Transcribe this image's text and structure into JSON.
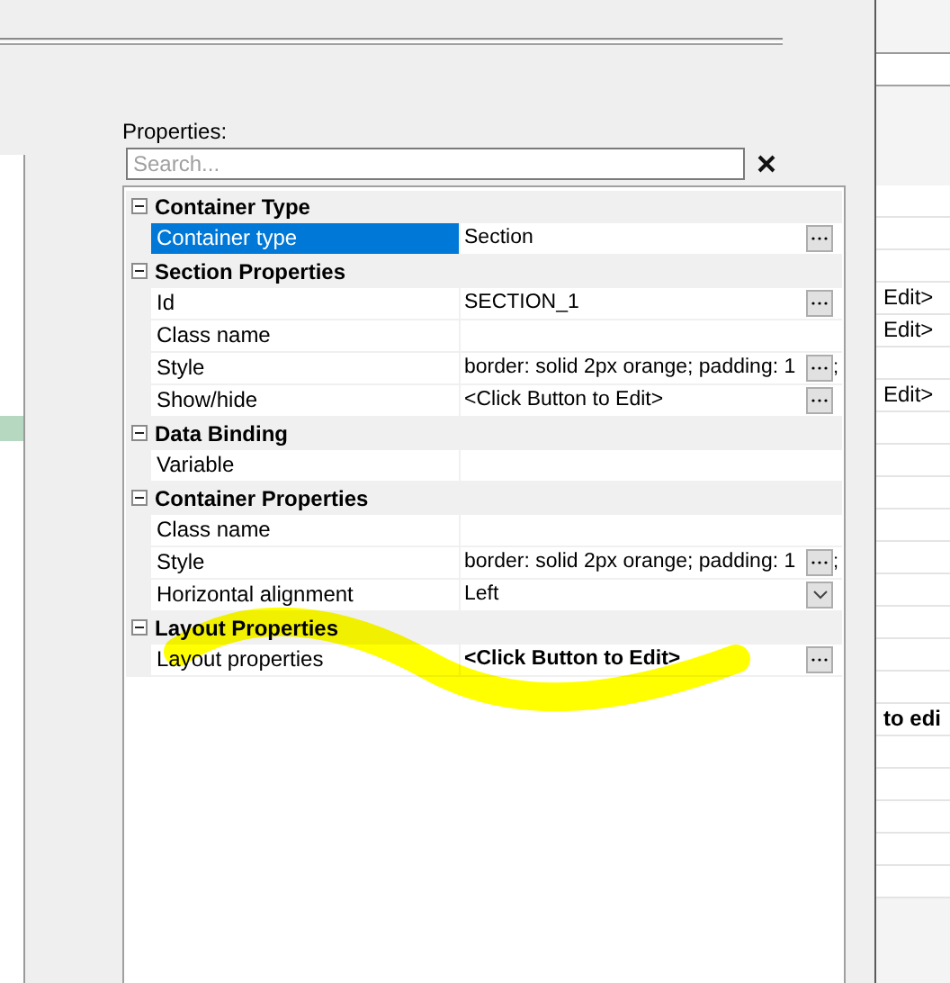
{
  "properties_panel": {
    "label": "Properties:",
    "search": {
      "placeholder": "Search..."
    },
    "categories": [
      {
        "title": "Container Type",
        "expanded": true,
        "properties": [
          {
            "name": "Container type",
            "value": "Section",
            "selected": true,
            "bold": false,
            "kind": "ellipsis"
          }
        ]
      },
      {
        "title": "Section Properties",
        "expanded": true,
        "properties": [
          {
            "name": "Id",
            "value": "SECTION_1",
            "selected": false,
            "bold": false,
            "kind": "ellipsis"
          },
          {
            "name": "Class name",
            "selected": false,
            "kind": "plain"
          },
          {
            "name": "Style",
            "value": "border: solid 2px orange; padding: 1",
            "value_tail": ";",
            "selected": false,
            "bold": false,
            "kind": "ellipsis"
          },
          {
            "name": "Show/hide",
            "value": "<Click Button to Edit>",
            "selected": false,
            "bold": false,
            "kind": "ellipsis"
          }
        ]
      },
      {
        "title": "Data Binding",
        "expanded": true,
        "properties": [
          {
            "name": "Variable",
            "selected": false,
            "kind": "plain"
          }
        ]
      },
      {
        "title": "Container Properties",
        "expanded": true,
        "properties": [
          {
            "name": "Class name",
            "selected": false,
            "kind": "plain"
          },
          {
            "name": "Style",
            "value": "border: solid 2px orange; padding: 1",
            "value_tail": ";",
            "selected": false,
            "bold": false,
            "kind": "ellipsis"
          },
          {
            "name": "Horizontal alignment",
            "value": "Left",
            "selected": false,
            "bold": false,
            "kind": "dropdown"
          }
        ]
      },
      {
        "title": "Layout Properties",
        "expanded": true,
        "properties": [
          {
            "name": "Layout properties",
            "value": "<Click Button to Edit>",
            "selected": false,
            "bold": true,
            "kind": "ellipsis"
          }
        ]
      }
    ]
  },
  "background_window": {
    "rows": [
      {
        "kind": "blank"
      },
      {
        "kind": "blank"
      },
      {
        "kind": "blank"
      },
      {
        "kind": "text",
        "text": "Edit>",
        "bold": false
      },
      {
        "kind": "text",
        "text": "Edit>",
        "bold": false
      },
      {
        "kind": "blank"
      },
      {
        "kind": "text",
        "text": "Edit>",
        "bold": false
      },
      {
        "kind": "blank"
      },
      {
        "kind": "blank"
      },
      {
        "kind": "blank"
      },
      {
        "kind": "blank"
      },
      {
        "kind": "blank"
      },
      {
        "kind": "blank"
      },
      {
        "kind": "blank"
      },
      {
        "kind": "blank"
      },
      {
        "kind": "blank"
      },
      {
        "kind": "text",
        "text": "to edi",
        "bold": true
      },
      {
        "kind": "blank"
      },
      {
        "kind": "blank"
      },
      {
        "kind": "blank"
      },
      {
        "kind": "blank"
      },
      {
        "kind": "blank"
      }
    ]
  }
}
